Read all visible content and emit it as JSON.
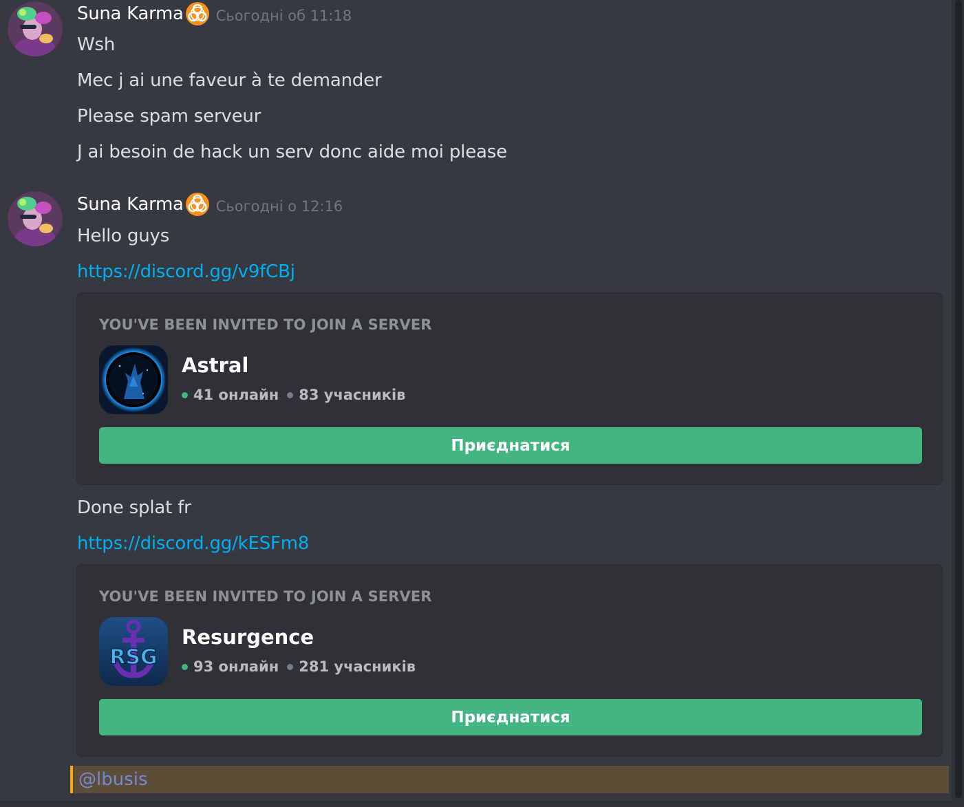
{
  "messages": [
    {
      "author": "Suna Karma",
      "timestamp": "Сьогодні об 11:18",
      "lines": [
        "Wsh",
        "Mec j ai une faveur à te demander",
        "Please spam serveur",
        "J ai besoin de hack un serv donc aide moi please"
      ]
    },
    {
      "author": "Suna Karma",
      "timestamp": "Сьогодні о 12:16",
      "text_1": "Hello guys",
      "link_1": "https://discord.gg/v9fCBj",
      "invite_1": {
        "header": "YOU'VE BEEN INVITED TO JOIN A SERVER",
        "server_name": "Astral",
        "online": "41 онлайн",
        "members": "83 учасників",
        "join_label": "Приєднатися"
      },
      "text_2": "Done splat fr",
      "link_2": "https://discord.gg/kESFm8",
      "invite_2": {
        "header": "YOU'VE BEEN INVITED TO JOIN A SERVER",
        "server_name": "Resurgence",
        "online": "93 онлайн",
        "members": "281 учасників",
        "join_label": "Приєднатися"
      },
      "mention": "@lbusis"
    }
  ],
  "colors": {
    "background": "#36393f",
    "embed_background": "#2f3136",
    "link": "#00b0f4",
    "join_button": "#43b581",
    "mention_highlight": "#5c4d37",
    "mention_accent": "#faa61a",
    "mention_text": "#7289da",
    "timestamp": "#72767d"
  },
  "icons": {
    "author_badge": "biohazard-icon",
    "online_indicator": "online-dot-icon",
    "members_indicator": "members-dot-icon"
  }
}
